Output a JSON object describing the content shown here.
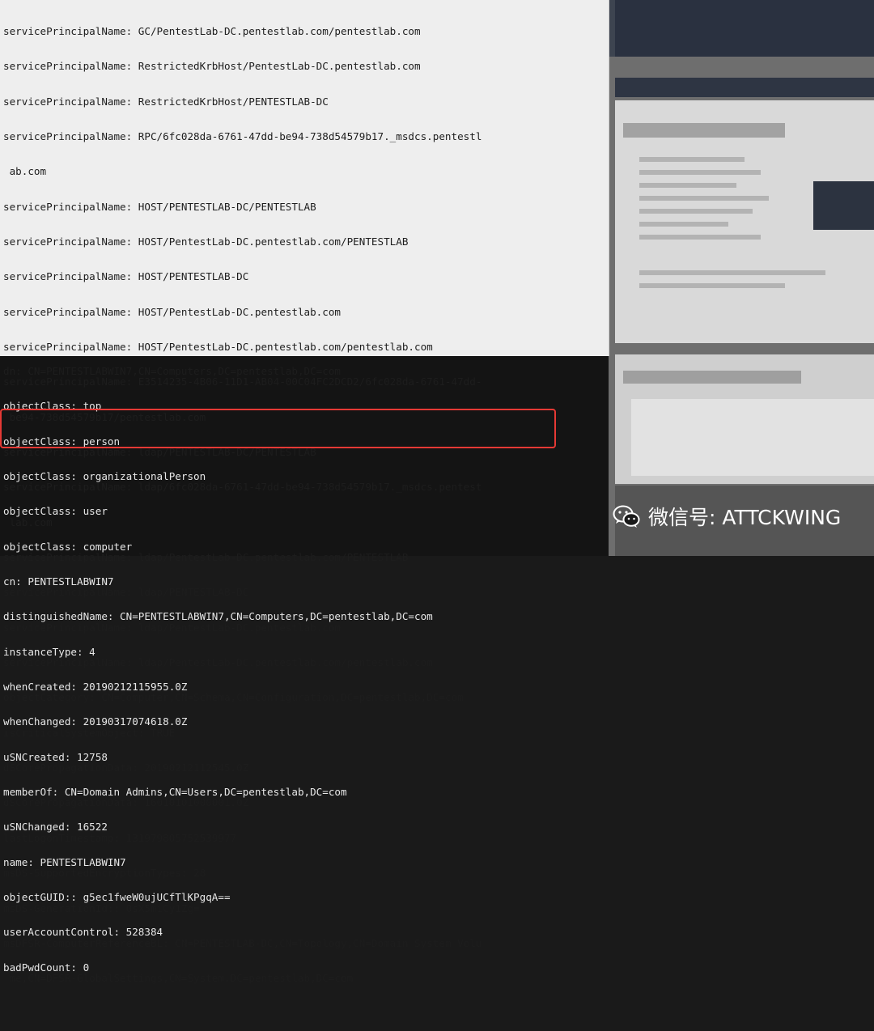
{
  "terminal_light_lines": [
    "servicePrincipalName: GC/PentestLab-DC.pentestlab.com/pentestlab.com",
    "servicePrincipalName: RestrictedKrbHost/PentestLab-DC.pentestlab.com",
    "servicePrincipalName: RestrictedKrbHost/PENTESTLAB-DC",
    "servicePrincipalName: RPC/6fc028da-6761-47dd-be94-738d54579b17._msdcs.pentestl",
    " ab.com",
    "servicePrincipalName: HOST/PENTESTLAB-DC/PENTESTLAB",
    "servicePrincipalName: HOST/PentestLab-DC.pentestlab.com/PENTESTLAB",
    "servicePrincipalName: HOST/PENTESTLAB-DC",
    "servicePrincipalName: HOST/PentestLab-DC.pentestlab.com",
    "servicePrincipalName: HOST/PentestLab-DC.pentestlab.com/pentestlab.com",
    "servicePrincipalName: E3514235-4B06-11D1-AB04-00C04FC2DCD2/6fc028da-6761-47dd-",
    " be94-738d54579b17/pentestlab.com",
    "servicePrincipalName: ldap/PENTESTLAB-DC/PENTESTLAB",
    "servicePrincipalName: ldap/6fc028da-6761-47dd-be94-738d54579b17._msdcs.pentest",
    " lab.com",
    "servicePrincipalName: ldap/PentestLab-DC.pentestlab.com/PENTESTLAB",
    "servicePrincipalName: ldap/PENTESTLAB-DC",
    "servicePrincipalName: ldap/PentestLab-DC.pentestlab.com",
    "servicePrincipalName: ldap/PentestLab-DC.pentestlab.com/pentestlab.com",
    "objectCategory: CN=Computer,CN=Schema,CN=Configuration,DC=pentestlab,DC=com",
    "isCriticalSystemObject: TRUE",
    "dSCorePropagationData: 20190212112545.0Z",
    "dSCorePropagationData: 16010101000001.0Z",
    "lastLogonTimestamp: 131979805752539977",
    "msDS-SupportedEncryptionTypes: 28",
    "msDS-GenerationId:: 0sX5miCy1Zg=",
    "msDFSR-ComputerReferenceBL: CN=PENTESTLAB-DC,CN=Topology,CN=Domain System Volu",
    " me,CN=DFSR-GlobalSettings,CN=System,DC=pentestlab,DC=com",
    ""
  ],
  "terminal_dark_lines": [
    "dn: CN=PENTESTLABWIN7,CN=Computers,DC=pentestlab,DC=com",
    "objectClass: top",
    "objectClass: person",
    "objectClass: organizationalPerson",
    "objectClass: user",
    "objectClass: computer",
    "cn: PENTESTLABWIN7",
    "distinguishedName: CN=PENTESTLABWIN7,CN=Computers,DC=pentestlab,DC=com",
    "instanceType: 4",
    "whenCreated: 20190212115955.0Z",
    "whenChanged: 20190317074618.0Z",
    "uSNCreated: 12758",
    "memberOf: CN=Domain Admins,CN=Users,DC=pentestlab,DC=com",
    "uSNChanged: 16522",
    "name: PENTESTLABWIN7",
    "objectGUID:: g5ec1fweW0ujUCfTlKPgqA==",
    "userAccountControl: 528384",
    "badPwdCount: 0"
  ],
  "watermark": {
    "icon": "wechat-icon",
    "text": "微信号: ATTCKWING"
  },
  "colors": {
    "highlight": "#e53935"
  }
}
